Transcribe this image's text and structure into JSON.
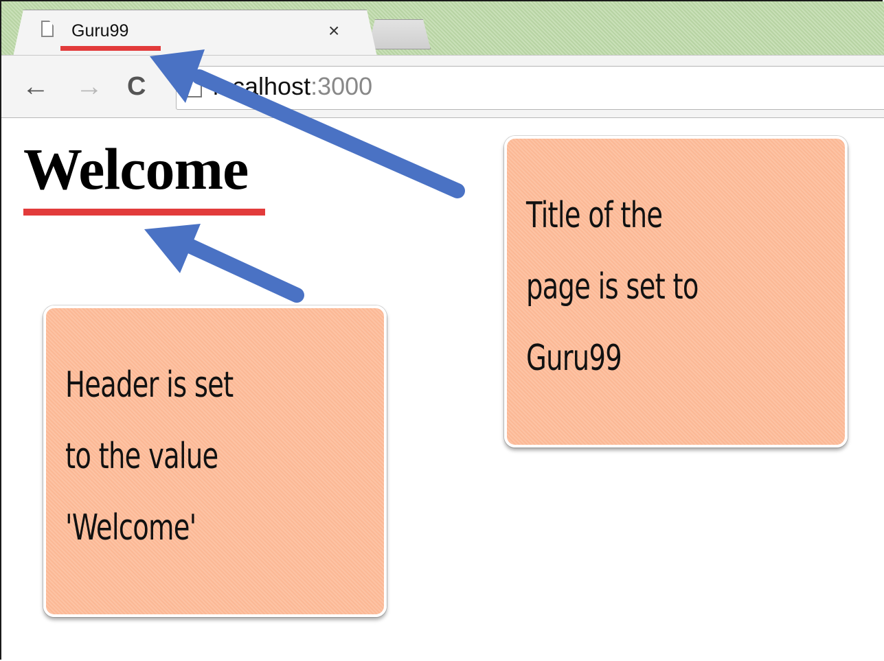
{
  "browser": {
    "tab": {
      "title": "Guru99",
      "close_glyph": "×",
      "favicon": "page-icon"
    },
    "toolbar": {
      "back_glyph": "←",
      "forward_glyph": "→",
      "reload_glyph": "C",
      "url_host": "localhost",
      "url_port": ":3000"
    }
  },
  "page": {
    "heading": "Welcome"
  },
  "annotations": {
    "title_note": {
      "lines": [
        "Title of the",
        "page is set to",
        "Guru99"
      ]
    },
    "header_note": {
      "lines": [
        "Header is set",
        "to the value",
        "'Welcome'"
      ]
    },
    "colors": {
      "note_fill": "#fdc3a4",
      "arrow": "#4a72c4",
      "highlight": "#e23b3b"
    }
  }
}
